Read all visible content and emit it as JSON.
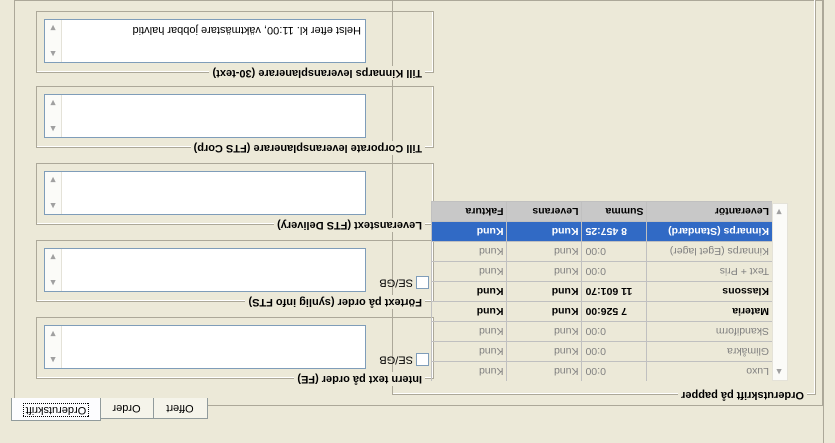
{
  "tabs": [
    "Offert",
    "Order",
    "Orderutskrift"
  ],
  "active_tab": "Orderutskrift",
  "print_group": {
    "title": "Orderutskrift på papper"
  },
  "fields": [
    {
      "label": "Till Kinnarps leveransplanerare (30-text)",
      "value": "Helst efter kl. 11:00, väktmästare jobbar halvtid",
      "has_checkbox": false
    },
    {
      "label": "Till Corporate leveransplanerare (FTS Corp)",
      "value": "",
      "has_checkbox": false
    },
    {
      "label": "Leveranstext (FTS Delivery)",
      "value": "",
      "has_checkbox": false
    },
    {
      "label": "Förtext på order (synlig info FTS)",
      "value": "",
      "has_checkbox": true,
      "checkbox_label": "SE/GB"
    },
    {
      "label": "Intern text på order (FE)",
      "value": "",
      "has_checkbox": true,
      "checkbox_label": "SE/GB"
    }
  ],
  "grid": {
    "columns": [
      "Leverantör",
      "Summa",
      "Leverans",
      "Faktura"
    ],
    "rows": [
      {
        "supplier": "Kinnarps (Standard)",
        "sum": "8 457:25",
        "delivery": "Kund",
        "invoice": "Kund",
        "style": "sel"
      },
      {
        "supplier": "Kinnarps (Eget lager)",
        "sum": "0:00",
        "delivery": "Kund",
        "invoice": "Kund",
        "style": "dim"
      },
      {
        "supplier": "Text + Pris",
        "sum": "0:00",
        "delivery": "Kund",
        "invoice": "Kund",
        "style": "dim"
      },
      {
        "supplier": "Klassons",
        "sum": "11 601:70",
        "delivery": "Kund",
        "invoice": "Kund",
        "style": "bold"
      },
      {
        "supplier": "Materia",
        "sum": "7 526:00",
        "delivery": "Kund",
        "invoice": "Kund",
        "style": "bold"
      },
      {
        "supplier": "Skandiform",
        "sum": "0:00",
        "delivery": "Kund",
        "invoice": "Kund",
        "style": "dim"
      },
      {
        "supplier": "Glimåkra",
        "sum": "0:00",
        "delivery": "Kund",
        "invoice": "Kund",
        "style": "dim"
      },
      {
        "supplier": "Luxo",
        "sum": "0:00",
        "delivery": "Kund",
        "invoice": "Kund",
        "style": "dim"
      }
    ]
  }
}
